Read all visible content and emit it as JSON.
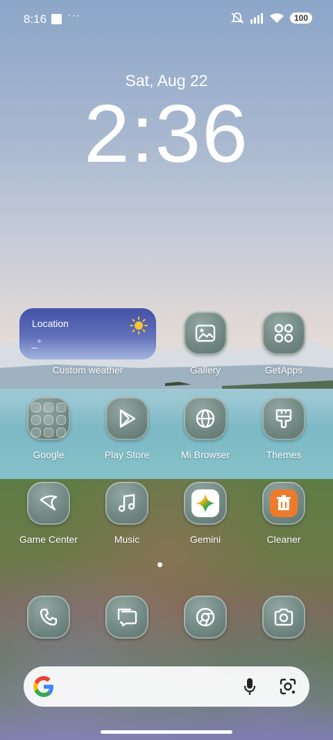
{
  "status_bar": {
    "time": "8:16",
    "more": "···",
    "battery": "100"
  },
  "lockclock": {
    "date": "Sat, Aug 22",
    "time": "2:36"
  },
  "weather_widget": {
    "location": "Location",
    "temp": "_°",
    "label": "Custom weather"
  },
  "apps": {
    "gallery": "Gallery",
    "getapps": "GetApps",
    "google": "Google",
    "playstore": "Play Store",
    "browser": "Mi Browser",
    "themes": "Themes",
    "gamecenter": "Game Center",
    "music": "Music",
    "gemini": "Gemini",
    "cleaner": "Cleaner"
  },
  "dock": [
    "phone-icon",
    "messages-icon",
    "chrome-icon",
    "camera-icon"
  ],
  "colors": {
    "widget": "#4a58ad",
    "icon": "#6f8580",
    "cleaner": "#f07a2b"
  }
}
